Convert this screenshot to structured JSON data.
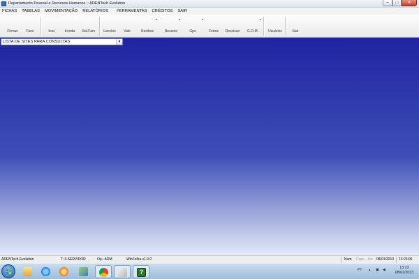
{
  "window": {
    "title": "Departamento Pessoal e Recursos Humanos :: ADENTech Evolution"
  },
  "menu": [
    "FICHAS",
    "TABELAS",
    "MOVIMENTAÇÃO",
    "RELATÓRIOS",
    "FERRAMENTAS",
    "CRÉDITOS",
    "SAIR"
  ],
  "toolbar": {
    "buttons": [
      "Firmas",
      "Func",
      "Inss",
      "Irenda",
      "Sal.Fam",
      "Lanctos",
      "Vale",
      "Recibos",
      "Resumo",
      "Gps",
      "Ferias",
      "Rescisao",
      "G.O.M.",
      "Usuários",
      "Sair"
    ]
  },
  "combo": {
    "value": "LISTA DE SITES PARA CONSULTAS"
  },
  "status": {
    "app": "ADENTech Evolution",
    "terminal": "T: 3-SERVIDOR",
    "operator": "Op.: ADM",
    "version": "WinFolha v1.0.0",
    "num": "Num",
    "caps": "Caps",
    "ins": "Ins",
    "date": "08/01/2013",
    "time": "13:23:05"
  },
  "taskbar": {
    "tray_lang": "PT",
    "clock_time": "13:23",
    "clock_date": "08/01/2013",
    "app_glyph": "?"
  },
  "icons": {
    "taskbar": [
      "start-orb-icon",
      "explorer-folder-icon",
      "internet-explorer-icon",
      "media-player-icon",
      "tools-icon",
      "chrome-icon",
      "paint-brush-icon",
      "winfolha-app-icon"
    ]
  },
  "colors": {
    "workspace_top": "#1f23a0",
    "workspace_bottom": "#e5eaf6",
    "close_button": "#c24430"
  }
}
